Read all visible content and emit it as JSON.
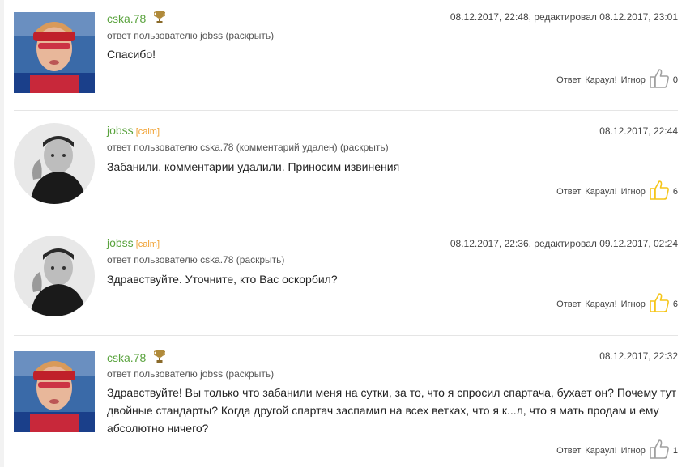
{
  "comments": [
    {
      "author": "cska.78",
      "tag": "",
      "has_trophy": true,
      "avatar": "photo-biathlete",
      "date": "08.12.2017, 22:48, редактировал 08.12.2017, 23:01",
      "reply_prefix": "ответ пользователю jobss",
      "reply_expand": "(раскрыть)",
      "text": "Спасибо!",
      "actions": [
        "Ответ",
        "Караул!",
        "Игнор"
      ],
      "likes": "0",
      "thumb_color": "#a0a0a0"
    },
    {
      "author": "jobss",
      "tag": "[calm]",
      "has_trophy": false,
      "avatar": "photo-bw-man",
      "date": "08.12.2017, 22:44",
      "reply_prefix": "ответ пользователю cska.78 (комментарий удален)",
      "reply_expand": "(раскрыть)",
      "text": "Забанили, комментарии удалили. Приносим извинения",
      "actions": [
        "Ответ",
        "Караул!",
        "Игнор"
      ],
      "likes": "6",
      "thumb_color": "#f5c518"
    },
    {
      "author": "jobss",
      "tag": "[calm]",
      "has_trophy": false,
      "avatar": "photo-bw-man",
      "date": "08.12.2017, 22:36, редактировал 09.12.2017, 02:24",
      "reply_prefix": "ответ пользователю cska.78",
      "reply_expand": "(раскрыть)",
      "text": "Здравствуйте. Уточните, кто Вас оскорбил?",
      "actions": [
        "Ответ",
        "Караул!",
        "Игнор"
      ],
      "likes": "6",
      "thumb_color": "#f5c518"
    },
    {
      "author": "cska.78",
      "tag": "",
      "has_trophy": true,
      "avatar": "photo-biathlete",
      "date": "08.12.2017, 22:32",
      "reply_prefix": "ответ пользователю jobss",
      "reply_expand": "(раскрыть)",
      "text": "Здравствуйте! Вы только что забанили меня на сутки, за то, что я спросил спартача, бухает он? Почему тут двойные стандарты? Когда другой спартач заспамил на всех ветках, что я к...л, что я мать продам и ему абсолютно ничего?",
      "actions": [
        "Ответ",
        "Караул!",
        "Игнор"
      ],
      "likes": "1",
      "thumb_color": "#a0a0a0"
    }
  ]
}
